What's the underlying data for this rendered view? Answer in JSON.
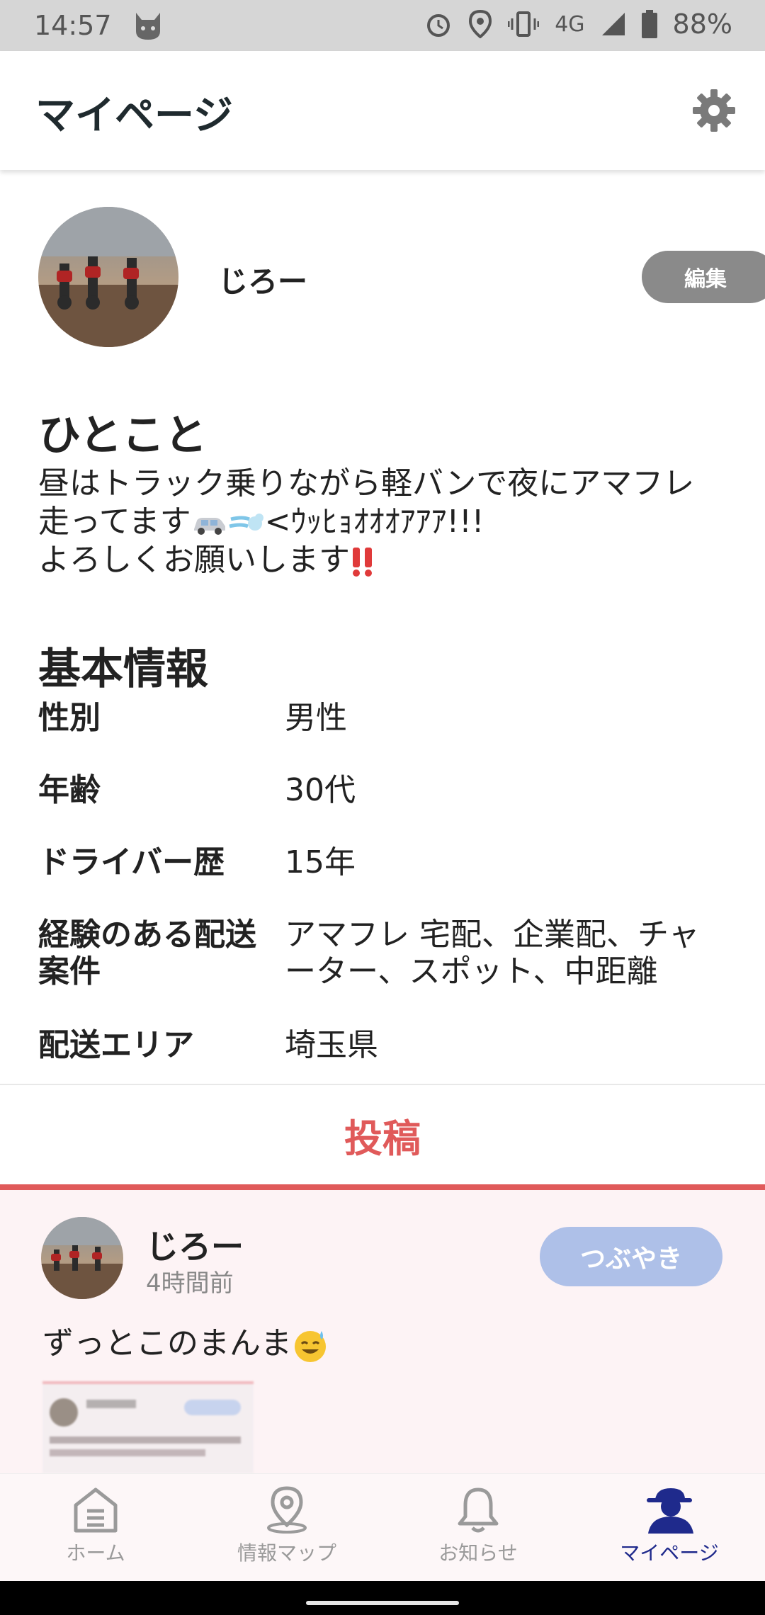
{
  "status_bar": {
    "time": "14:57",
    "network": "4G",
    "battery": "88%",
    "icons": [
      "cat-icon",
      "alarm-icon",
      "location-icon",
      "vibrate-icon",
      "signal-icon",
      "battery-icon"
    ]
  },
  "header": {
    "title": "マイページ",
    "settings_icon": "gear-icon"
  },
  "profile": {
    "name": "じろー",
    "edit_label": "編集"
  },
  "hitokoto": {
    "title": "ひとこと",
    "line1": "昼はトラック乗りながら軽バンで夜にアマフレ",
    "line2_text": "走ってます",
    "line2_tail": "<ｳｯﾋｮｵｵｵｱｱｱ!!!",
    "line3_text": "よろしくお願いします",
    "emoji_icons": [
      "car-icon",
      "dash-icon",
      "double-exclamation-icon"
    ]
  },
  "basic_info": {
    "title": "基本情報",
    "rows": [
      {
        "label": "性別",
        "value": "男性"
      },
      {
        "label": "年齢",
        "value": "30代"
      },
      {
        "label": "ドライバー歴",
        "value": "15年"
      },
      {
        "label_line1": "経験のある配送",
        "label_line2": "案件",
        "value_line1": "アマフレ 宅配、企業配、チャ",
        "value_line2": "ーター、スポット、中距離"
      },
      {
        "label": "配送エリア",
        "value": "埼玉県"
      }
    ]
  },
  "tabs": {
    "active": "投稿"
  },
  "post": {
    "name": "じろー",
    "time": "4時間前",
    "type": "つぶやき",
    "text": "ずっとこのまんま",
    "emoji_icon": "sweat-smile-icon"
  },
  "bottom_nav": [
    {
      "label": "ホーム",
      "icon": "home-icon",
      "active": false
    },
    {
      "label": "情報マップ",
      "icon": "map-pin-icon",
      "active": false
    },
    {
      "label": "お知らせ",
      "icon": "bell-icon",
      "active": false
    },
    {
      "label": "マイページ",
      "icon": "user-icon",
      "active": true
    }
  ],
  "colors": {
    "accent": "#e05a5a",
    "nav_active": "#1f2a8c",
    "post_bg": "#fdf3f5",
    "badge": "#aec0e8"
  }
}
